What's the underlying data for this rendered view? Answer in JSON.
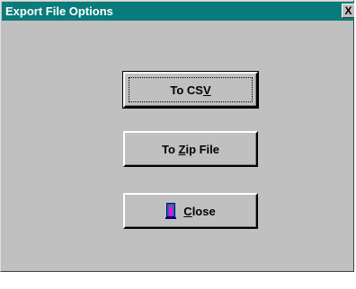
{
  "window": {
    "title": "Export File Options",
    "close_glyph": "X"
  },
  "buttons": {
    "csv": {
      "pre": "To CS",
      "mnemonic": "V",
      "post": ""
    },
    "zip": {
      "pre": "To ",
      "mnemonic": "Z",
      "post": "ip File"
    },
    "close": {
      "pre": "",
      "mnemonic": "C",
      "post": "lose",
      "icon": "door-exit-icon"
    }
  },
  "colors": {
    "titlebar": "#0a7b7b",
    "face": "#c0c0c0"
  }
}
